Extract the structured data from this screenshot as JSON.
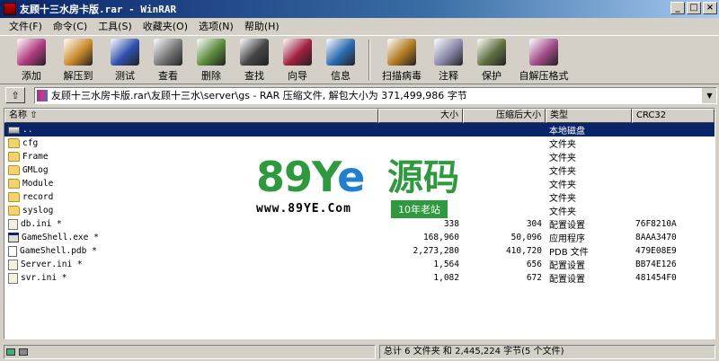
{
  "window": {
    "title": "友顾十三水房卡版.rar - WinRAR"
  },
  "menu": [
    "文件(F)",
    "命令(C)",
    "工具(S)",
    "收藏夹(O)",
    "选项(N)",
    "帮助(H)"
  ],
  "toolbar": [
    {
      "label": "添加",
      "icon": "add-archive-icon",
      "color": "#b03a80"
    },
    {
      "label": "解压到",
      "icon": "extract-to-icon",
      "color": "#c98a2a"
    },
    {
      "label": "测试",
      "icon": "test-icon",
      "color": "#3050b0"
    },
    {
      "label": "查看",
      "icon": "view-icon",
      "color": "#777777"
    },
    {
      "label": "删除",
      "icon": "delete-icon",
      "color": "#5a8a3a"
    },
    {
      "label": "查找",
      "icon": "find-icon",
      "color": "#444444"
    },
    {
      "label": "向导",
      "icon": "wizard-icon",
      "color": "#a02040"
    },
    {
      "label": "信息",
      "icon": "info-icon",
      "color": "#2a6ab0"
    },
    {
      "label": "扫描病毒",
      "icon": "virus-scan-icon",
      "color": "#b07a20"
    },
    {
      "label": "注释",
      "icon": "comment-icon",
      "color": "#8888aa"
    },
    {
      "label": "保护",
      "icon": "protect-icon",
      "color": "#607040"
    },
    {
      "label": "自解压格式",
      "icon": "sfx-icon",
      "color": "#a04a8a"
    }
  ],
  "address": {
    "path": "友顾十三水房卡版.rar\\友顾十三水\\server\\gs - RAR 压缩文件, 解包大小为 371,499,986 字节"
  },
  "columns": {
    "name": "名称",
    "size": "大小",
    "packed": "压缩后大小",
    "type": "类型",
    "crc": "CRC32"
  },
  "files": [
    {
      "name": "..",
      "size": "",
      "packed": "",
      "type": "本地磁盘",
      "crc": "",
      "icon": "drive"
    },
    {
      "name": "cfg",
      "size": "",
      "packed": "",
      "type": "文件夹",
      "crc": "",
      "icon": "folder"
    },
    {
      "name": "Frame",
      "size": "",
      "packed": "",
      "type": "文件夹",
      "crc": "",
      "icon": "folder"
    },
    {
      "name": "GMLog",
      "size": "",
      "packed": "",
      "type": "文件夹",
      "crc": "",
      "icon": "folder"
    },
    {
      "name": "Module",
      "size": "",
      "packed": "",
      "type": "文件夹",
      "crc": "",
      "icon": "folder"
    },
    {
      "name": "record",
      "size": "",
      "packed": "",
      "type": "文件夹",
      "crc": "",
      "icon": "folder"
    },
    {
      "name": "syslog",
      "size": "",
      "packed": "",
      "type": "文件夹",
      "crc": "",
      "icon": "folder"
    },
    {
      "name": "db.ini *",
      "size": "338",
      "packed": "304",
      "type": "配置设置",
      "crc": "76F8210A",
      "icon": "ini"
    },
    {
      "name": "GameShell.exe *",
      "size": "168,960",
      "packed": "50,096",
      "type": "应用程序",
      "crc": "8AAA3470",
      "icon": "exe"
    },
    {
      "name": "GameShell.pdb *",
      "size": "2,273,280",
      "packed": "410,720",
      "type": "PDB 文件",
      "crc": "479E08E9",
      "icon": "file"
    },
    {
      "name": "Server.ini *",
      "size": "1,564",
      "packed": "656",
      "type": "配置设置",
      "crc": "BB74E126",
      "icon": "ini"
    },
    {
      "name": "svr.ini *",
      "size": "1,082",
      "packed": "672",
      "type": "配置设置",
      "crc": "481454F0",
      "icon": "ini"
    }
  ],
  "watermark": {
    "brand_a": "89Y",
    "brand_e": "e",
    "brand_cn": "源码",
    "url": "www.89YE.Com",
    "tag": "10年老站"
  },
  "status": {
    "summary": "总计 6 文件夹 和 2,445,224 字节(5 个文件)"
  }
}
